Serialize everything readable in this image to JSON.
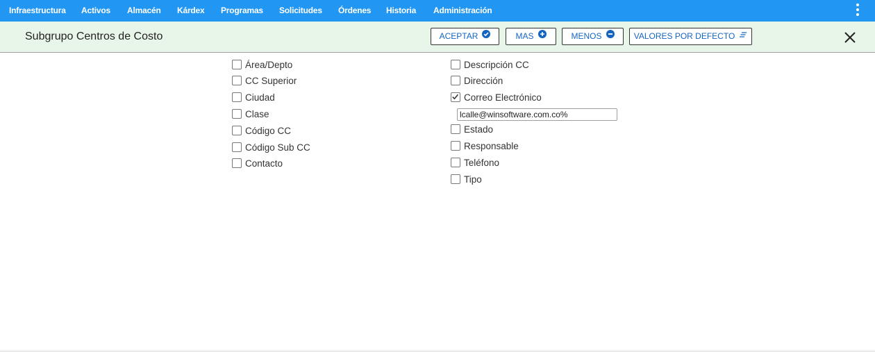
{
  "nav": {
    "items": [
      {
        "label": "Infraestructura"
      },
      {
        "label": "Activos"
      },
      {
        "label": "Almacén"
      },
      {
        "label": "Kárdex"
      },
      {
        "label": "Programas"
      },
      {
        "label": "Solicitudes"
      },
      {
        "label": "Órdenes"
      },
      {
        "label": "Historia"
      },
      {
        "label": "Administración"
      }
    ],
    "menu_icon": "more-vertical-icon"
  },
  "header": {
    "title": "Subgrupo Centros de Costo",
    "buttons": {
      "aceptar": {
        "label": "ACEPTAR",
        "icon": "check-circle-icon"
      },
      "mas": {
        "label": "MAS",
        "icon": "plus-circle-icon"
      },
      "menos": {
        "label": "MENOS",
        "icon": "minus-circle-icon"
      },
      "defecto": {
        "label": "VALORES POR DEFECTO",
        "icon": "lines-icon"
      }
    },
    "close_icon": "close-icon"
  },
  "filters": {
    "left": [
      {
        "label": "Área/Depto",
        "checked": false
      },
      {
        "label": "CC Superior",
        "checked": false
      },
      {
        "label": "Ciudad",
        "checked": false
      },
      {
        "label": "Clase",
        "checked": false
      },
      {
        "label": "Código CC",
        "checked": false
      },
      {
        "label": "Código Sub CC",
        "checked": false
      },
      {
        "label": "Contacto",
        "checked": false
      }
    ],
    "right": [
      {
        "label": "Descripción CC",
        "checked": false
      },
      {
        "label": "Dirección",
        "checked": false
      },
      {
        "label": "Correo Electrónico",
        "checked": true
      },
      {
        "label": "Estado",
        "checked": false
      },
      {
        "label": "Responsable",
        "checked": false
      },
      {
        "label": "Teléfono",
        "checked": false
      },
      {
        "label": "Tipo",
        "checked": false
      }
    ],
    "email_value": "lcalle@winsoftware.com.co%"
  },
  "colors": {
    "primary": "#2196f3",
    "header_bg": "#e8f5e9",
    "button_text": "#1565c0"
  }
}
